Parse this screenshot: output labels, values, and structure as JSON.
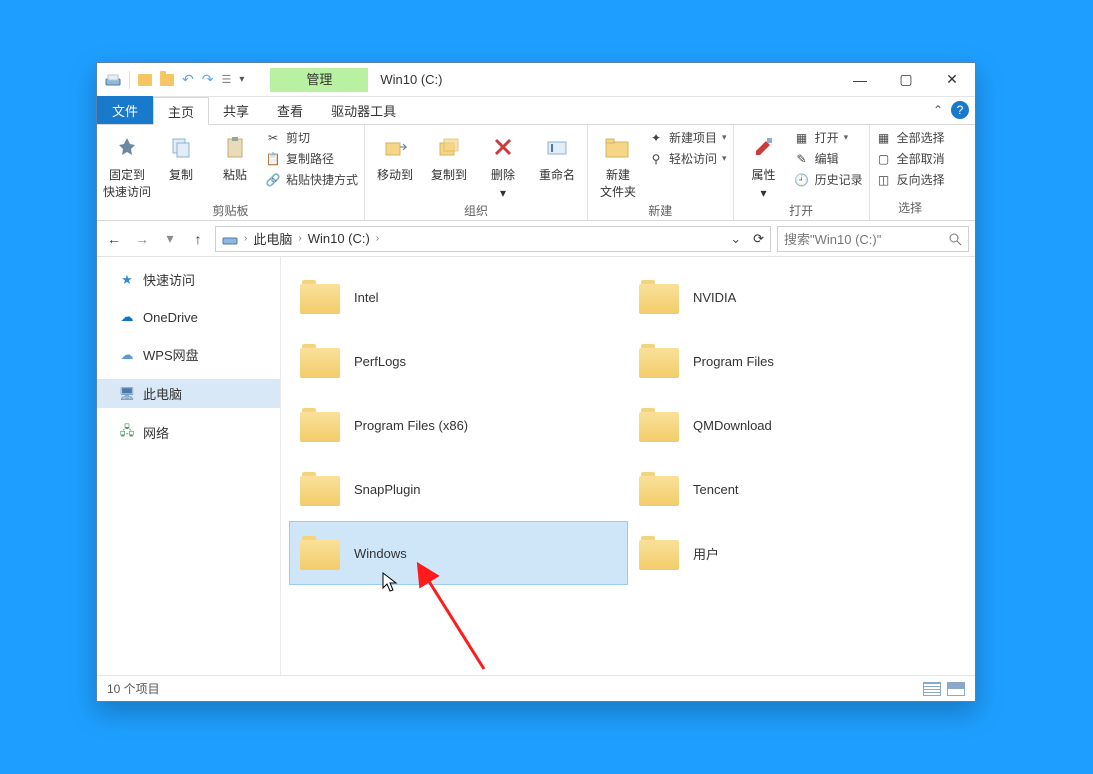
{
  "title": "Win10 (C:)",
  "context_tab": "管理",
  "tabs": {
    "file": "文件",
    "home": "主页",
    "share": "共享",
    "view": "查看",
    "drive_tools": "驱动器工具"
  },
  "ribbon": {
    "clipboard": {
      "pin": "固定到\n快速访问",
      "copy": "复制",
      "paste": "粘贴",
      "cut": "剪切",
      "copy_path": "复制路径",
      "paste_shortcut": "粘贴快捷方式",
      "label": "剪贴板"
    },
    "organize": {
      "move_to": "移动到",
      "copy_to": "复制到",
      "delete": "删除",
      "rename": "重命名",
      "label": "组织"
    },
    "new": {
      "new_folder": "新建\n文件夹",
      "new_item": "新建项目",
      "easy_access": "轻松访问",
      "label": "新建"
    },
    "open": {
      "properties": "属性",
      "open": "打开",
      "edit": "编辑",
      "history": "历史记录",
      "label": "打开"
    },
    "select": {
      "select_all": "全部选择",
      "select_none": "全部取消",
      "invert": "反向选择",
      "label": "选择"
    }
  },
  "breadcrumb": {
    "root": "此电脑",
    "drive": "Win10 (C:)"
  },
  "search_placeholder": "搜索\"Win10 (C:)\"",
  "nav": {
    "quick": "快速访问",
    "onedrive": "OneDrive",
    "wps": "WPS网盘",
    "thispc": "此电脑",
    "network": "网络"
  },
  "folders": [
    {
      "name": "Intel",
      "selected": false
    },
    {
      "name": "NVIDIA",
      "selected": false
    },
    {
      "name": "PerfLogs",
      "selected": false
    },
    {
      "name": "Program Files",
      "selected": false
    },
    {
      "name": "Program Files (x86)",
      "selected": false
    },
    {
      "name": "QMDownload",
      "selected": false
    },
    {
      "name": "SnapPlugin",
      "selected": false
    },
    {
      "name": "Tencent",
      "selected": false
    },
    {
      "name": "Windows",
      "selected": true
    },
    {
      "name": "用户",
      "selected": false
    }
  ],
  "status": "10 个项目"
}
